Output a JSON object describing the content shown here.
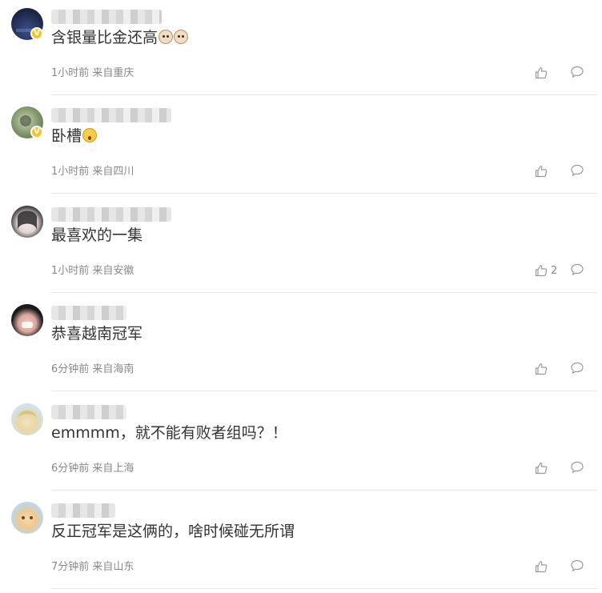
{
  "comments": [
    {
      "text": "含银量比金还高",
      "meta": "1小时前 来自重庆",
      "like_count": "",
      "verified": true,
      "avatar_colors": [
        "#1c2547",
        "#3a4f8a"
      ],
      "emojis": [
        "cat-face-icon",
        "cat-face-icon"
      ]
    },
    {
      "text": "卧槽",
      "meta": "1小时前 来自四川",
      "like_count": "",
      "verified": true,
      "avatar_colors": [
        "#5f7a4e",
        "#c9d4b8"
      ],
      "emojis": [
        "surprised-face-icon"
      ]
    },
    {
      "text": "最喜欢的一集",
      "meta": "1小时前 来自安徽",
      "like_count": "2",
      "verified": false,
      "avatar_colors": [
        "#e9dede",
        "#2a2a2a"
      ],
      "emojis": []
    },
    {
      "text": "恭喜越南冠军",
      "meta": "6分钟前 来自海南",
      "like_count": "",
      "verified": false,
      "avatar_colors": [
        "#1a1a1a",
        "#f0c8c0"
      ],
      "emojis": []
    },
    {
      "text": "emmmm，就不能有败者组吗？！",
      "meta": "6分钟前 来自上海",
      "like_count": "",
      "verified": false,
      "avatar_colors": [
        "#cfe3ee",
        "#e8d7a6"
      ],
      "emojis": []
    },
    {
      "text": "反正冠军是这俩的，啥时候碰无所谓",
      "meta": "7分钟前 来自山东",
      "like_count": "",
      "verified": false,
      "avatar_colors": [
        "#b8d8f0",
        "#f4d9b0"
      ],
      "emojis": []
    }
  ],
  "colors": {
    "text": "#333333",
    "meta": "#888888",
    "icon": "#999999",
    "divider": "#e8e8e8",
    "verified_badge": "#f7c325"
  },
  "icons": {
    "like": "thumbs-up-icon",
    "reply": "speech-bubble-icon",
    "verified": "verified-badge-icon"
  },
  "verified_mark": "V"
}
